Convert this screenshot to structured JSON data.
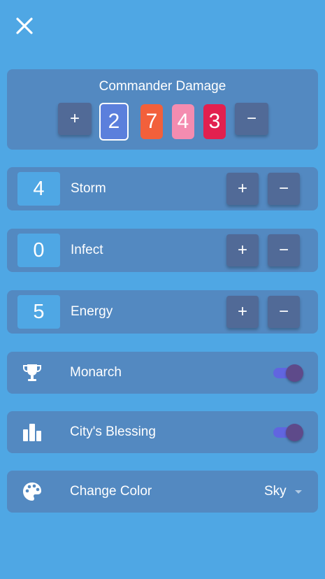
{
  "close_icon": "close-icon",
  "commander_damage": {
    "title": "Commander Damage",
    "plus_label": "+",
    "minus_label": "−",
    "opponents": [
      {
        "value": "2",
        "color": "#5b7fdc",
        "selected": true
      },
      {
        "value": "7",
        "color": "#f2603b",
        "selected": false
      },
      {
        "value": "4",
        "color": "#f48cb0",
        "selected": false
      },
      {
        "value": "3",
        "color": "#e2204f",
        "selected": false
      }
    ]
  },
  "counters": [
    {
      "value": "4",
      "label": "Storm",
      "plus": "+",
      "minus": "−"
    },
    {
      "value": "0",
      "label": "Infect",
      "plus": "+",
      "minus": "−"
    },
    {
      "value": "5",
      "label": "Energy",
      "plus": "+",
      "minus": "−"
    }
  ],
  "toggles": [
    {
      "label": "Monarch",
      "icon": "trophy-icon",
      "on": true
    },
    {
      "label": "City's Blessing",
      "icon": "city-icon",
      "on": true
    }
  ],
  "change_color": {
    "label": "Change Color",
    "icon": "palette-icon",
    "value": "Sky"
  },
  "colors": {
    "background": "#4fa7e4",
    "card": "#5389c1",
    "button": "#516a97",
    "switch_track": "#6165e0",
    "switch_knob": "#5e4a8a"
  }
}
